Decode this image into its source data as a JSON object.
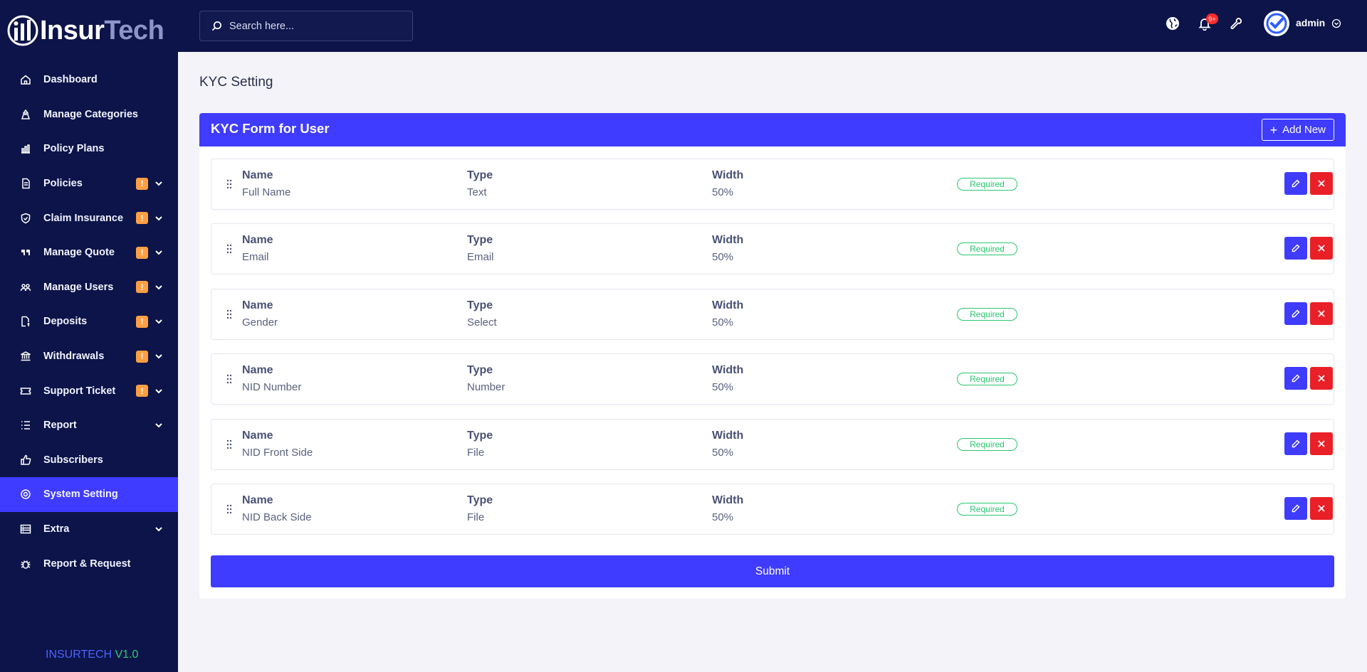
{
  "brand": {
    "name_part1": "Insur",
    "name_part2": "Tech",
    "version_part1": "INSURTECH",
    "version_part2": "V1.0"
  },
  "colors": {
    "sidebar_bg": "#0c1449",
    "accent": "#3f3bff",
    "badge": "#ff9f43",
    "danger": "#ea2028",
    "success": "#28c76f"
  },
  "search": {
    "placeholder": "Search here..."
  },
  "topbar": {
    "notification_count": "9+",
    "user_name": "admin"
  },
  "sidebar": {
    "items": [
      {
        "label": "Dashboard",
        "icon": "home-icon",
        "badge": "",
        "has_submenu": false,
        "active": false
      },
      {
        "label": "Manage Categories",
        "icon": "categories-icon",
        "badge": "",
        "has_submenu": false,
        "active": false
      },
      {
        "label": "Policy Plans",
        "icon": "bar-chart-icon",
        "badge": "",
        "has_submenu": false,
        "active": false
      },
      {
        "label": "Policies",
        "icon": "document-icon",
        "badge": "!",
        "has_submenu": true,
        "active": false
      },
      {
        "label": "Claim Insurance",
        "icon": "shield-icon",
        "badge": "!",
        "has_submenu": true,
        "active": false
      },
      {
        "label": "Manage Quote",
        "icon": "quote-icon",
        "badge": "!",
        "has_submenu": true,
        "active": false
      },
      {
        "label": "Manage Users",
        "icon": "users-icon",
        "badge": "!",
        "has_submenu": true,
        "active": false
      },
      {
        "label": "Deposits",
        "icon": "deposit-icon",
        "badge": "!",
        "has_submenu": true,
        "active": false
      },
      {
        "label": "Withdrawals",
        "icon": "bank-icon",
        "badge": "!",
        "has_submenu": true,
        "active": false
      },
      {
        "label": "Support Ticket",
        "icon": "ticket-icon",
        "badge": "!",
        "has_submenu": true,
        "active": false
      },
      {
        "label": "Report",
        "icon": "list-icon",
        "badge": "",
        "has_submenu": true,
        "active": false
      },
      {
        "label": "Subscribers",
        "icon": "thumbs-up-icon",
        "badge": "",
        "has_submenu": false,
        "active": false
      },
      {
        "label": "System Setting",
        "icon": "settings-icon",
        "badge": "",
        "has_submenu": false,
        "active": true
      },
      {
        "label": "Extra",
        "icon": "server-icon",
        "badge": "",
        "has_submenu": true,
        "active": false
      },
      {
        "label": "Report & Request",
        "icon": "bug-icon",
        "badge": "",
        "has_submenu": false,
        "active": false
      }
    ]
  },
  "page": {
    "title": "KYC Setting"
  },
  "card": {
    "title": "KYC Form for User",
    "add_label": "Add New",
    "submit_label": "Submit"
  },
  "fields_header": {
    "name": "Name",
    "type": "Type",
    "width": "Width"
  },
  "kyc_fields": [
    {
      "name": "Full Name",
      "type": "Text",
      "width": "50%",
      "status": "Required"
    },
    {
      "name": "Email",
      "type": "Email",
      "width": "50%",
      "status": "Required"
    },
    {
      "name": "Gender",
      "type": "Select",
      "width": "50%",
      "status": "Required"
    },
    {
      "name": "NID Number",
      "type": "Number",
      "width": "50%",
      "status": "Required"
    },
    {
      "name": "NID Front Side",
      "type": "File",
      "width": "50%",
      "status": "Required"
    },
    {
      "name": "NID Back Side",
      "type": "File",
      "width": "50%",
      "status": "Required"
    }
  ]
}
